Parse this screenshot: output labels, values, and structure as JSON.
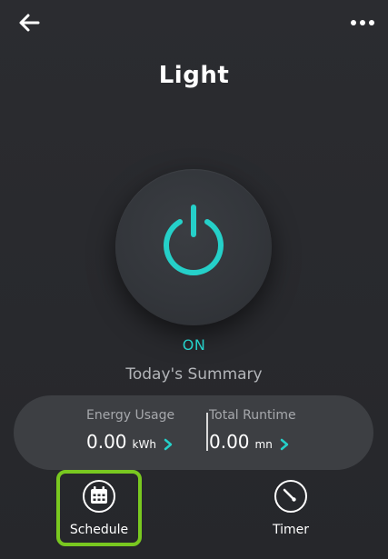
{
  "header": {
    "back_icon": "arrow-left-icon",
    "more_icon": "more-horizontal-icon",
    "title": "Light"
  },
  "power": {
    "icon": "power-icon",
    "accent_color": "#25d0c9",
    "status": "ON"
  },
  "summary": {
    "title": "Today's Summary",
    "energy": {
      "label": "Energy Usage",
      "value": "0.00",
      "unit": "kWh"
    },
    "runtime": {
      "label": "Total Runtime",
      "value": "0.00",
      "unit": "mn"
    }
  },
  "actions": {
    "schedule": {
      "label": "Schedule",
      "icon": "calendar-icon",
      "highlight_color": "#79c820"
    },
    "timer": {
      "label": "Timer",
      "icon": "timer-icon"
    }
  }
}
